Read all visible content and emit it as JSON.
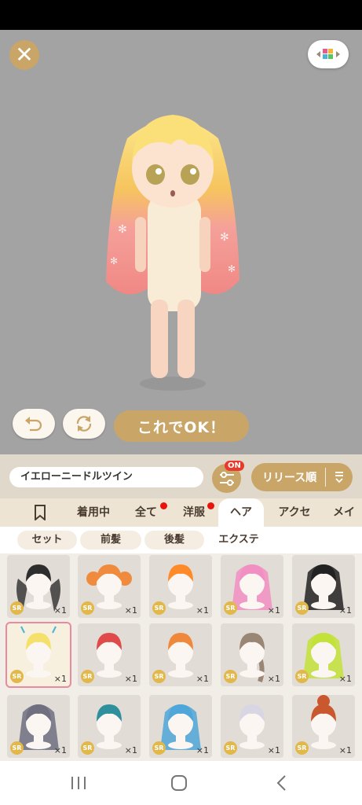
{
  "item_name": "イエローニードルツイン",
  "ok_label": "これでOK！",
  "filter_badge": "ON",
  "sort_label": "リリース順",
  "tabs": [
    {
      "label": "",
      "icon": "bookmark-icon"
    },
    {
      "label": "着用中"
    },
    {
      "label": "全て",
      "dot": true
    },
    {
      "label": "洋服",
      "dot": true
    },
    {
      "label": "ヘア",
      "active": true
    },
    {
      "label": "アクセ"
    },
    {
      "label": "メイ"
    }
  ],
  "subtabs": [
    {
      "label": "セット",
      "active": true
    },
    {
      "label": "前髪",
      "active": true
    },
    {
      "label": "後髪",
      "active": true
    },
    {
      "label": "エクステ",
      "active": false
    }
  ],
  "items": [
    {
      "name": "black-twin-hair",
      "rarity": "SR",
      "qty": "×1",
      "hair_color": "#2e2e2e",
      "style": "twin"
    },
    {
      "name": "orange-bun-hair",
      "rarity": "SR",
      "qty": "×1",
      "hair_color": "#f08a3c",
      "style": "buns"
    },
    {
      "name": "orange-ribbon-hair",
      "rarity": "SR",
      "qty": "×1",
      "hair_color": "#ff8a2a",
      "style": "short"
    },
    {
      "name": "pink-long-hair",
      "rarity": "SR",
      "qty": "×1",
      "hair_color": "#f28fc2",
      "style": "long"
    },
    {
      "name": "black-straight-hair",
      "rarity": "SR",
      "qty": "×1",
      "hair_color": "#222222",
      "style": "long"
    },
    {
      "name": "yellow-needle-hair",
      "rarity": "SR",
      "qty": "×1",
      "hair_color": "#f4e06b",
      "style": "short",
      "selected": true
    },
    {
      "name": "red-wavy-hair",
      "rarity": "SR",
      "qty": "×1",
      "hair_color": "#e04a4a",
      "style": "short"
    },
    {
      "name": "orange-side-hair",
      "rarity": "SR",
      "qty": "×1",
      "hair_color": "#f0883c",
      "style": "short"
    },
    {
      "name": "brown-braid-hair",
      "rarity": "SR",
      "qty": "×1",
      "hair_color": "#9a8674",
      "style": "braid"
    },
    {
      "name": "lime-green-hair",
      "rarity": "SR",
      "qty": "×1",
      "hair_color": "#c2e23a",
      "style": "long"
    },
    {
      "name": "gray-long-hair",
      "rarity": "SR",
      "qty": "×1",
      "hair_color": "#6f6f80",
      "style": "long"
    },
    {
      "name": "teal-curly-hair",
      "rarity": "SR",
      "qty": "×1",
      "hair_color": "#2f8f9c",
      "style": "short"
    },
    {
      "name": "blue-long-hair",
      "rarity": "SR",
      "qty": "×1",
      "hair_color": "#4fa6d8",
      "style": "long"
    },
    {
      "name": "silver-wavy-hair",
      "rarity": "SR",
      "qty": "×1",
      "hair_color": "#d8d6e2",
      "style": "short"
    },
    {
      "name": "auburn-bun-hair",
      "rarity": "SR",
      "qty": "×1",
      "hair_color": "#c9582f",
      "style": "bun"
    }
  ],
  "colors": {
    "accent": "#c9a567",
    "badge_red": "#e8392b",
    "stage_bg": "#a3a3a3"
  }
}
